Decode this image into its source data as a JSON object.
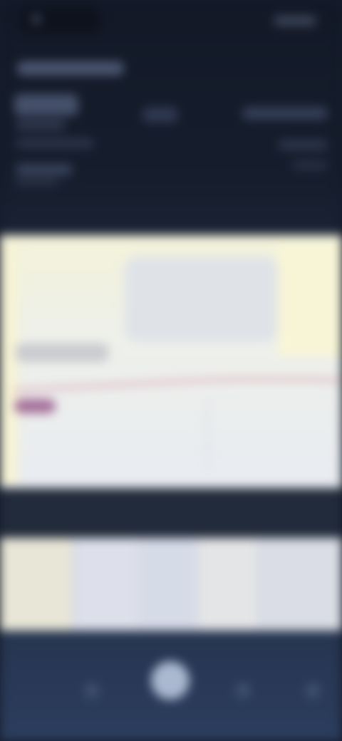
{
  "theme": {
    "header_bg": "#141c2b",
    "card_bg": "#eef0ea",
    "accent": "#a36d98",
    "nav_bg": "#2a3a58"
  },
  "header": {
    "status_icon": "app-icon",
    "menu_icon": "menu-icon"
  },
  "card": {
    "image_icon": "image-placeholder",
    "line_color": "#c9607a"
  },
  "bottom_nav": {
    "items": [
      {
        "icon": "back-icon"
      },
      {
        "icon": "home-icon"
      },
      {
        "icon": "recent-icon"
      },
      {
        "icon": "more-icon"
      }
    ]
  }
}
